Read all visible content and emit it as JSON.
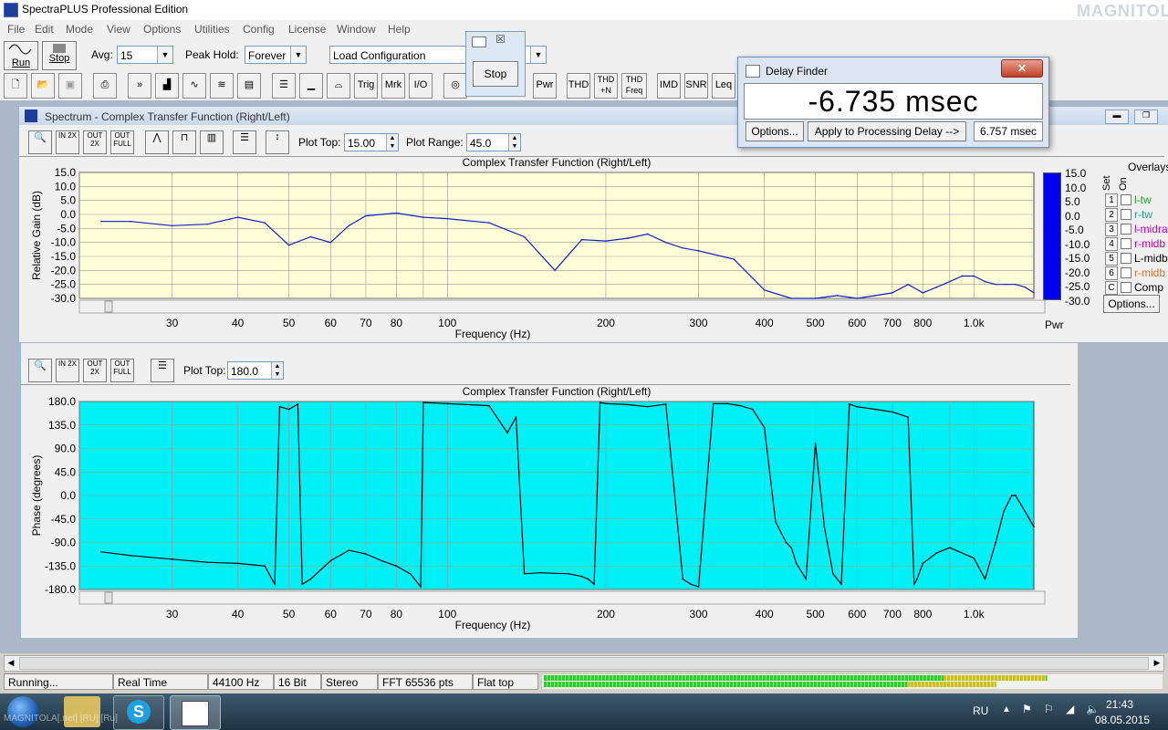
{
  "app": {
    "title": "SpectraPLUS Professional Edition",
    "menu": [
      "File",
      "Edit",
      "Mode",
      "View",
      "Options",
      "Utilities",
      "Config",
      "License",
      "Window",
      "Help"
    ],
    "watermark": "MAGNITOLA"
  },
  "toolbar1": {
    "run_label": "Run",
    "stop_label": "Stop",
    "avg_label": "Avg:",
    "avg_value": "15",
    "peak_hold_label": "Peak Hold:",
    "peak_hold_value": "Forever",
    "config_value": "Load Configuration"
  },
  "toolbar2": {
    "text_buttons": [
      "Trig",
      "Mrk",
      "I/O",
      "Pwr",
      "THD",
      "THD +N",
      "THD Freq",
      "IMD",
      "SNR",
      "Leq"
    ]
  },
  "stop_popup": {
    "stop_label": "Stop"
  },
  "delay_finder": {
    "title": "Delay Finder",
    "readout": "-6.735 msec",
    "options_label": "Options...",
    "apply_label": "Apply to Processing Delay -->",
    "delay_value": "6.757 msec"
  },
  "spectrum": {
    "window_title": "Spectrum - Complex Transfer Function (Right/Left)",
    "plot_top_label": "Plot Top:",
    "plot_top_value": "15.00",
    "plot_range_label": "Plot Range:",
    "plot_range_value": "45.0",
    "overlays_label": "Overlays",
    "set_label": "Set",
    "on_label": "On",
    "overlays": [
      {
        "num": "1",
        "name": "l-tw",
        "color": "#2aa02a"
      },
      {
        "num": "2",
        "name": "r-tw",
        "color": "#1aa0a0"
      },
      {
        "num": "3",
        "name": "l-midra",
        "color": "#c000c0"
      },
      {
        "num": "4",
        "name": "r-midb",
        "color": "#c000c0"
      },
      {
        "num": "5",
        "name": "L-midb",
        "color": "#000000"
      },
      {
        "num": "6",
        "name": "r-midb",
        "color": "#e07030"
      },
      {
        "num": "C",
        "name": "Comp",
        "color": "#000000"
      }
    ],
    "options_label": "Options...",
    "pwr_label": "Pwr",
    "pwr_scale": [
      "15.0",
      "10.0",
      "5.0",
      "0.0",
      "-5.0",
      "-10.0",
      "-15.0",
      "-20.0",
      "-25.0",
      "-30.0"
    ]
  },
  "phase": {
    "plot_top_label": "Plot Top:",
    "plot_top_value": "180.0"
  },
  "chart_data": [
    {
      "type": "line",
      "title": "Complex Transfer Function (Right/Left)",
      "xlabel": "Frequency (Hz)",
      "ylabel": "Relative Gain (dB)",
      "xscale": "log",
      "xlim": [
        20,
        1300
      ],
      "ylim": [
        -30,
        15
      ],
      "yticks": [
        "15.0",
        "10.0",
        "5.0",
        "0.0",
        "-5.0",
        "-10.0",
        "-15.0",
        "-20.0",
        "-25.0",
        "-30.0"
      ],
      "xticks": [
        "30",
        "40",
        "50",
        "60",
        "70",
        "80",
        "100",
        "200",
        "300",
        "400",
        "500",
        "600",
        "700",
        "800",
        "1.0k"
      ],
      "grid": true,
      "background": "#ffffd8",
      "series": [
        {
          "color": "#1020d0",
          "x": [
            22,
            25,
            30,
            35,
            40,
            45,
            50,
            55,
            60,
            65,
            70,
            80,
            90,
            100,
            120,
            140,
            160,
            180,
            200,
            220,
            240,
            260,
            280,
            300,
            350,
            400,
            450,
            500,
            550,
            600,
            650,
            700,
            750,
            800,
            850,
            900,
            950,
            1000,
            1050,
            1100,
            1150,
            1200,
            1250,
            1300
          ],
          "y": [
            -2.5,
            -2.5,
            -4,
            -3.5,
            -1,
            -3,
            -11,
            -8,
            -10,
            -4,
            -0.5,
            0.5,
            -1,
            -1.5,
            -3,
            -8,
            -20,
            -9,
            -9.5,
            -8.5,
            -7,
            -10,
            -12,
            -13,
            -16,
            -27,
            -30,
            -30,
            -29,
            -30,
            -29,
            -28,
            -25,
            -28,
            -26,
            -24,
            -22,
            -22,
            -24,
            -25,
            -25,
            -25,
            -26,
            -28
          ]
        }
      ]
    },
    {
      "type": "line",
      "title": "Complex Transfer Function (Right/Left)",
      "xlabel": "Frequency (Hz)",
      "ylabel": "Phase (degrees)",
      "xscale": "log",
      "xlim": [
        20,
        1300
      ],
      "ylim": [
        -180,
        180
      ],
      "yticks": [
        "180.0",
        "135.0",
        "90.0",
        "45.0",
        "0.0",
        "-45.0",
        "-90.0",
        "-135.0",
        "-180.0"
      ],
      "xticks": [
        "30",
        "40",
        "50",
        "60",
        "70",
        "80",
        "100",
        "200",
        "300",
        "400",
        "500",
        "600",
        "700",
        "800",
        "1.0k"
      ],
      "grid": true,
      "background": "#00f0f8",
      "series": [
        {
          "color": "#000000",
          "x": [
            22,
            25,
            30,
            35,
            40,
            45,
            47,
            48,
            50,
            52,
            53,
            55,
            60,
            65,
            70,
            75,
            80,
            85,
            89,
            90,
            100,
            120,
            130,
            135,
            140,
            150,
            170,
            180,
            185,
            190,
            195,
            200,
            220,
            240,
            260,
            280,
            290,
            300,
            320,
            340,
            360,
            380,
            400,
            420,
            440,
            450,
            460,
            480,
            500,
            520,
            540,
            560,
            580,
            600,
            650,
            700,
            750,
            770,
            780,
            800,
            850,
            900,
            1000,
            1050,
            1100,
            1120,
            1140,
            1180,
            1200,
            1250,
            1300
          ],
          "y": [
            -108,
            -115,
            -122,
            -128,
            -130,
            -135,
            -170,
            170,
            165,
            175,
            -170,
            -160,
            -125,
            -105,
            -112,
            -125,
            -135,
            -150,
            -175,
            178,
            176,
            172,
            120,
            150,
            -150,
            -148,
            -150,
            -155,
            -160,
            -170,
            178,
            176,
            174,
            170,
            175,
            -160,
            -170,
            -175,
            176,
            176,
            172,
            165,
            130,
            -50,
            -90,
            -100,
            -130,
            -160,
            100,
            -60,
            -150,
            -170,
            175,
            170,
            165,
            160,
            150,
            -170,
            -160,
            -130,
            -110,
            -100,
            -120,
            -160,
            -90,
            -60,
            -30,
            0,
            0,
            -30,
            -60
          ]
        }
      ]
    }
  ],
  "status": {
    "cells": [
      "Running...",
      "Real Time",
      "44100 Hz",
      "16 Bit",
      "Stereo",
      "FFT 65536 pts",
      "Flat top"
    ]
  },
  "taskbar": {
    "lang": "RU",
    "time": "21:43",
    "date": "08.05.2015",
    "overlay_text": "MAGNITOLA[.net]  [RU]  [Ru]"
  }
}
